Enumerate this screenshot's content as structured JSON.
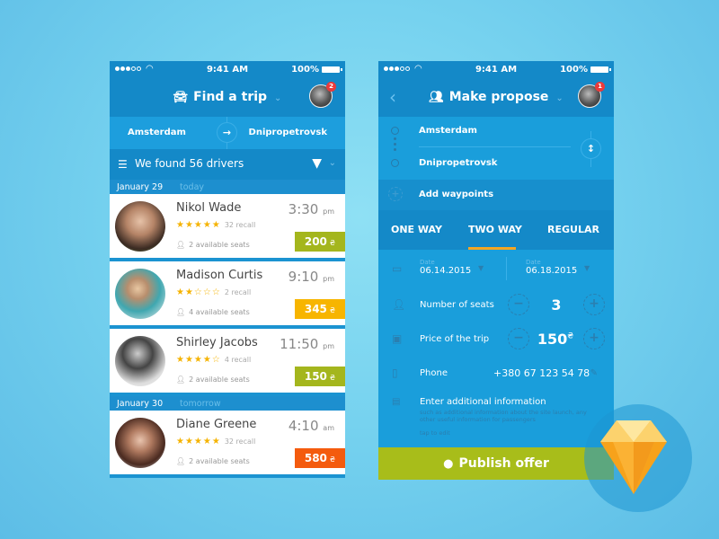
{
  "status_bar": {
    "time": "9:41 AM",
    "battery": "100%",
    "signal_full": 3,
    "signal_total": 5
  },
  "screen1": {
    "nav": {
      "title": "Find a trip",
      "title_icon": "car-icon",
      "notifications": "2"
    },
    "route": {
      "from": "Amsterdam",
      "to": "Dnipropetrovsk"
    },
    "results": {
      "text": "We found 56 drivers"
    },
    "groups": [
      {
        "date": "January 29",
        "relative": "today",
        "drivers": [
          {
            "name": "Nikol Wade",
            "time": "3:30",
            "ampm": "pm",
            "rating": 5,
            "stars": "★★★★★",
            "recall": "32 recall",
            "seats": "2 available seats",
            "price": "200",
            "currency": "₴",
            "price_color": "#a4b61d"
          },
          {
            "name": "Madison Curtis",
            "time": "9:10",
            "ampm": "pm",
            "rating": 2,
            "stars": "★★☆☆☆",
            "recall": "2 recall",
            "seats": "4 available seats",
            "price": "345",
            "currency": "₴",
            "price_color": "#f7b500"
          },
          {
            "name": "Shirley Jacobs",
            "time": "11:50",
            "ampm": "pm",
            "rating": 4,
            "stars": "★★★★☆",
            "recall": "4 recall",
            "seats": "2 available seats",
            "price": "150",
            "currency": "₴",
            "price_color": "#a4b61d"
          }
        ]
      },
      {
        "date": "January 30",
        "relative": "tomorrow",
        "drivers": [
          {
            "name": "Diane Greene",
            "time": "4:10",
            "ampm": "am",
            "rating": 5,
            "stars": "★★★★★",
            "recall": "32 recall",
            "seats": "2 available seats",
            "price": "580",
            "currency": "₴",
            "price_color": "#f45b0e"
          }
        ]
      }
    ]
  },
  "screen2": {
    "nav": {
      "title": "Make propose",
      "title_icon": "group-icon",
      "notifications": "1"
    },
    "route": {
      "from": "Amsterdam",
      "to": "Dnipropetrovsk",
      "add_waypoints": "Add waypoints"
    },
    "tabs": [
      {
        "label": "ONE WAY",
        "active": false
      },
      {
        "label": "TWO WAY",
        "active": true
      },
      {
        "label": "REGULAR",
        "active": false
      }
    ],
    "dates": [
      {
        "label": "Date",
        "value": "06.14.2015"
      },
      {
        "label": "Date",
        "value": "06.18.2015"
      }
    ],
    "seats": {
      "label": "Number of seats",
      "value": "3"
    },
    "price": {
      "label": "Price of the trip",
      "value": "150",
      "currency": "₴"
    },
    "phone": {
      "label": "Phone",
      "value": "+380 67 123 54 78"
    },
    "info": {
      "title": "Enter additional information",
      "subtitle": "such as additional information about the site launch, any other useful information for passengers",
      "edit_hint": "tap to edit"
    },
    "publish_label": "Publish offer"
  },
  "colors": {
    "primary": "#1489c8",
    "accent_tab": "#f5a623",
    "publish": "#a8bd1a"
  }
}
